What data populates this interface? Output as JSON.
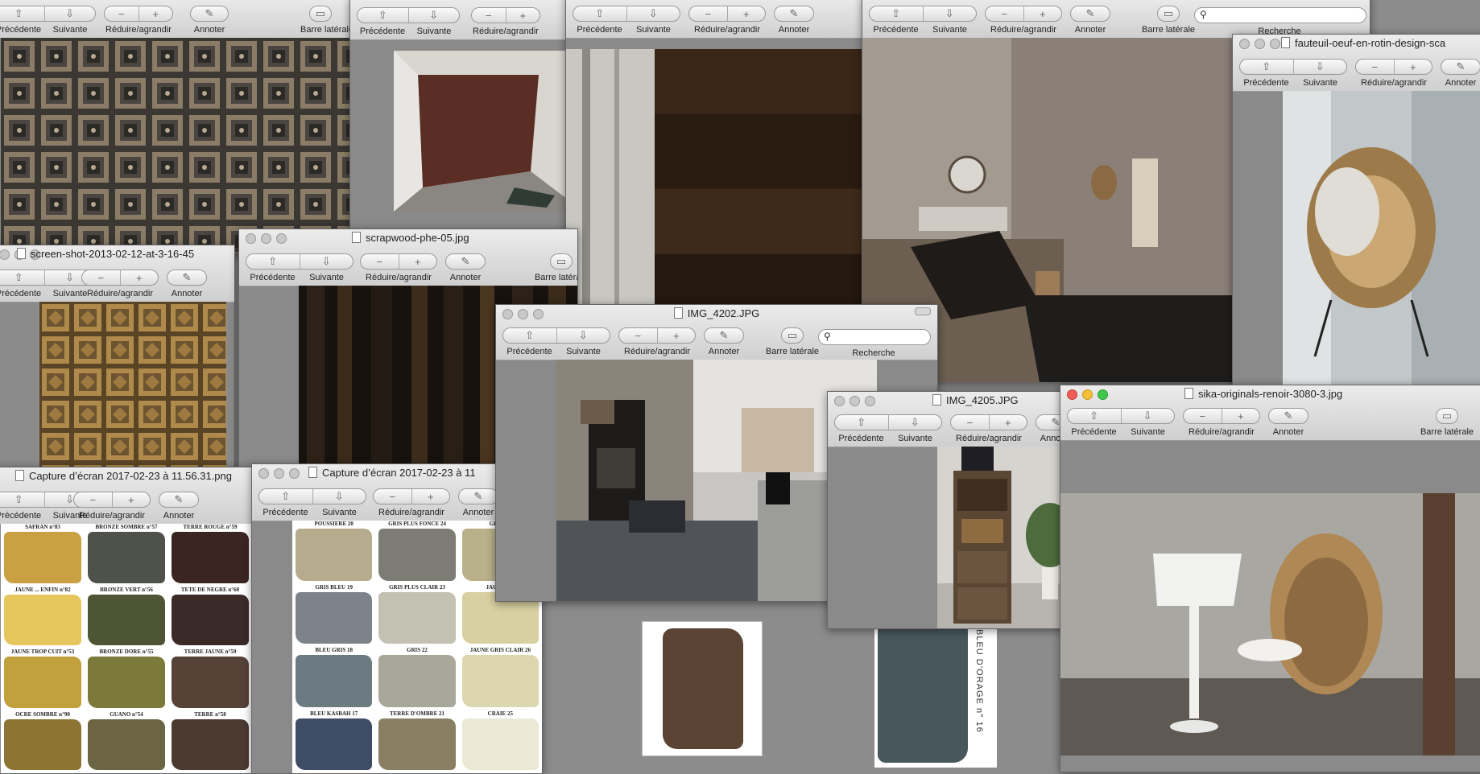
{
  "toolbar_labels": {
    "prev": "Précédente",
    "next": "Suivante",
    "zoom": "Réduire/agrandir",
    "annotate": "Annoter",
    "sidebar": "Barre latérale",
    "search": "Recherche"
  },
  "icons": {
    "prev": "up-arrow-icon",
    "next": "down-arrow-icon",
    "zoom_out": "minus-icon",
    "zoom_in": "plus-icon",
    "annotate": "pencil-icon",
    "sidebar": "sidebar-icon",
    "search": "magnifier-icon"
  },
  "windows": {
    "w_tiles": {
      "title": ""
    },
    "w_room": {
      "title": ""
    },
    "w_wood": {
      "title": ""
    },
    "w_bedroom": {
      "title": ""
    },
    "w_fauteuil": {
      "title": "fauteuil-oeuf-en-rotin-design-sca"
    },
    "w_screenshot": {
      "title": "screen-shot-2013-02-12-at-3-16-45"
    },
    "w_scrapwood": {
      "title": "scrapwood-phe-05.jpg"
    },
    "w_img4202": {
      "title": "IMG_4202.JPG"
    },
    "w_img4205": {
      "title": "IMG_4205.JPG"
    },
    "w_sika": {
      "title": "sika-originals-renoir-3080-3.jpg"
    },
    "w_capture1": {
      "title": "Capture d’écran 2017-02-23 à 11.56.31.png"
    },
    "w_capture2": {
      "title": "Capture d’écran 2017-02-23 à 11"
    }
  },
  "paint_chart_1": [
    {
      "label": "SAFRAN n°83",
      "color": "#c9a043"
    },
    {
      "label": "BRONZE SOMBRE n°57",
      "color": "#4f524a"
    },
    {
      "label": "TERRE ROUGE n°59",
      "color": "#3b2522"
    },
    {
      "label": "JAUNE ... ENFIN n°82",
      "color": "#e5c65c"
    },
    {
      "label": "BRONZE VERT n°56",
      "color": "#4e5534"
    },
    {
      "label": "TETE DE NEGRE n°60",
      "color": "#3a2a28"
    },
    {
      "label": "JAUNE TROP CUIT n°53",
      "color": "#c2a13d"
    },
    {
      "label": "BRONZE DORE n°55",
      "color": "#7c7a3a"
    },
    {
      "label": "TERRE JAUNE n°59",
      "color": "#574237"
    },
    {
      "label": "OCRE SOMBRE n°90",
      "color": "#8e7432"
    },
    {
      "label": "GUANO n°54",
      "color": "#6c6543"
    },
    {
      "label": "TERRE n°58",
      "color": "#4b3a30"
    }
  ],
  "paint_chart_2": [
    {
      "label": "POUSSIERE 20",
      "color": "#b6ab8d"
    },
    {
      "label": "GRIS PLUS FONCE 24",
      "color": "#7d7c74"
    },
    {
      "label": "GRIS JA",
      "color": "#b9b18a"
    },
    {
      "label": "GRIS BLEU 19",
      "color": "#7c838a"
    },
    {
      "label": "GRIS PLUS CLAIR 23",
      "color": "#c2c1b2"
    },
    {
      "label": "JAUNE GR",
      "color": "#d8d0a0"
    },
    {
      "label": "BLEU GRIS 18",
      "color": "#6c7b82"
    },
    {
      "label": "GRIS 22",
      "color": "#a9a79a"
    },
    {
      "label": "JAUNE GRIS CLAIR 26",
      "color": "#dcd7ae"
    },
    {
      "label": "BLEU KASBAH 17",
      "color": "#3f4c66"
    },
    {
      "label": "TERRE D'OMBRE 21",
      "color": "#8a7e63"
    },
    {
      "label": "CRAIE 25",
      "color": "#ece8d6"
    }
  ],
  "swatch_blue_label": "BLEU D’ORAGE n° 16"
}
